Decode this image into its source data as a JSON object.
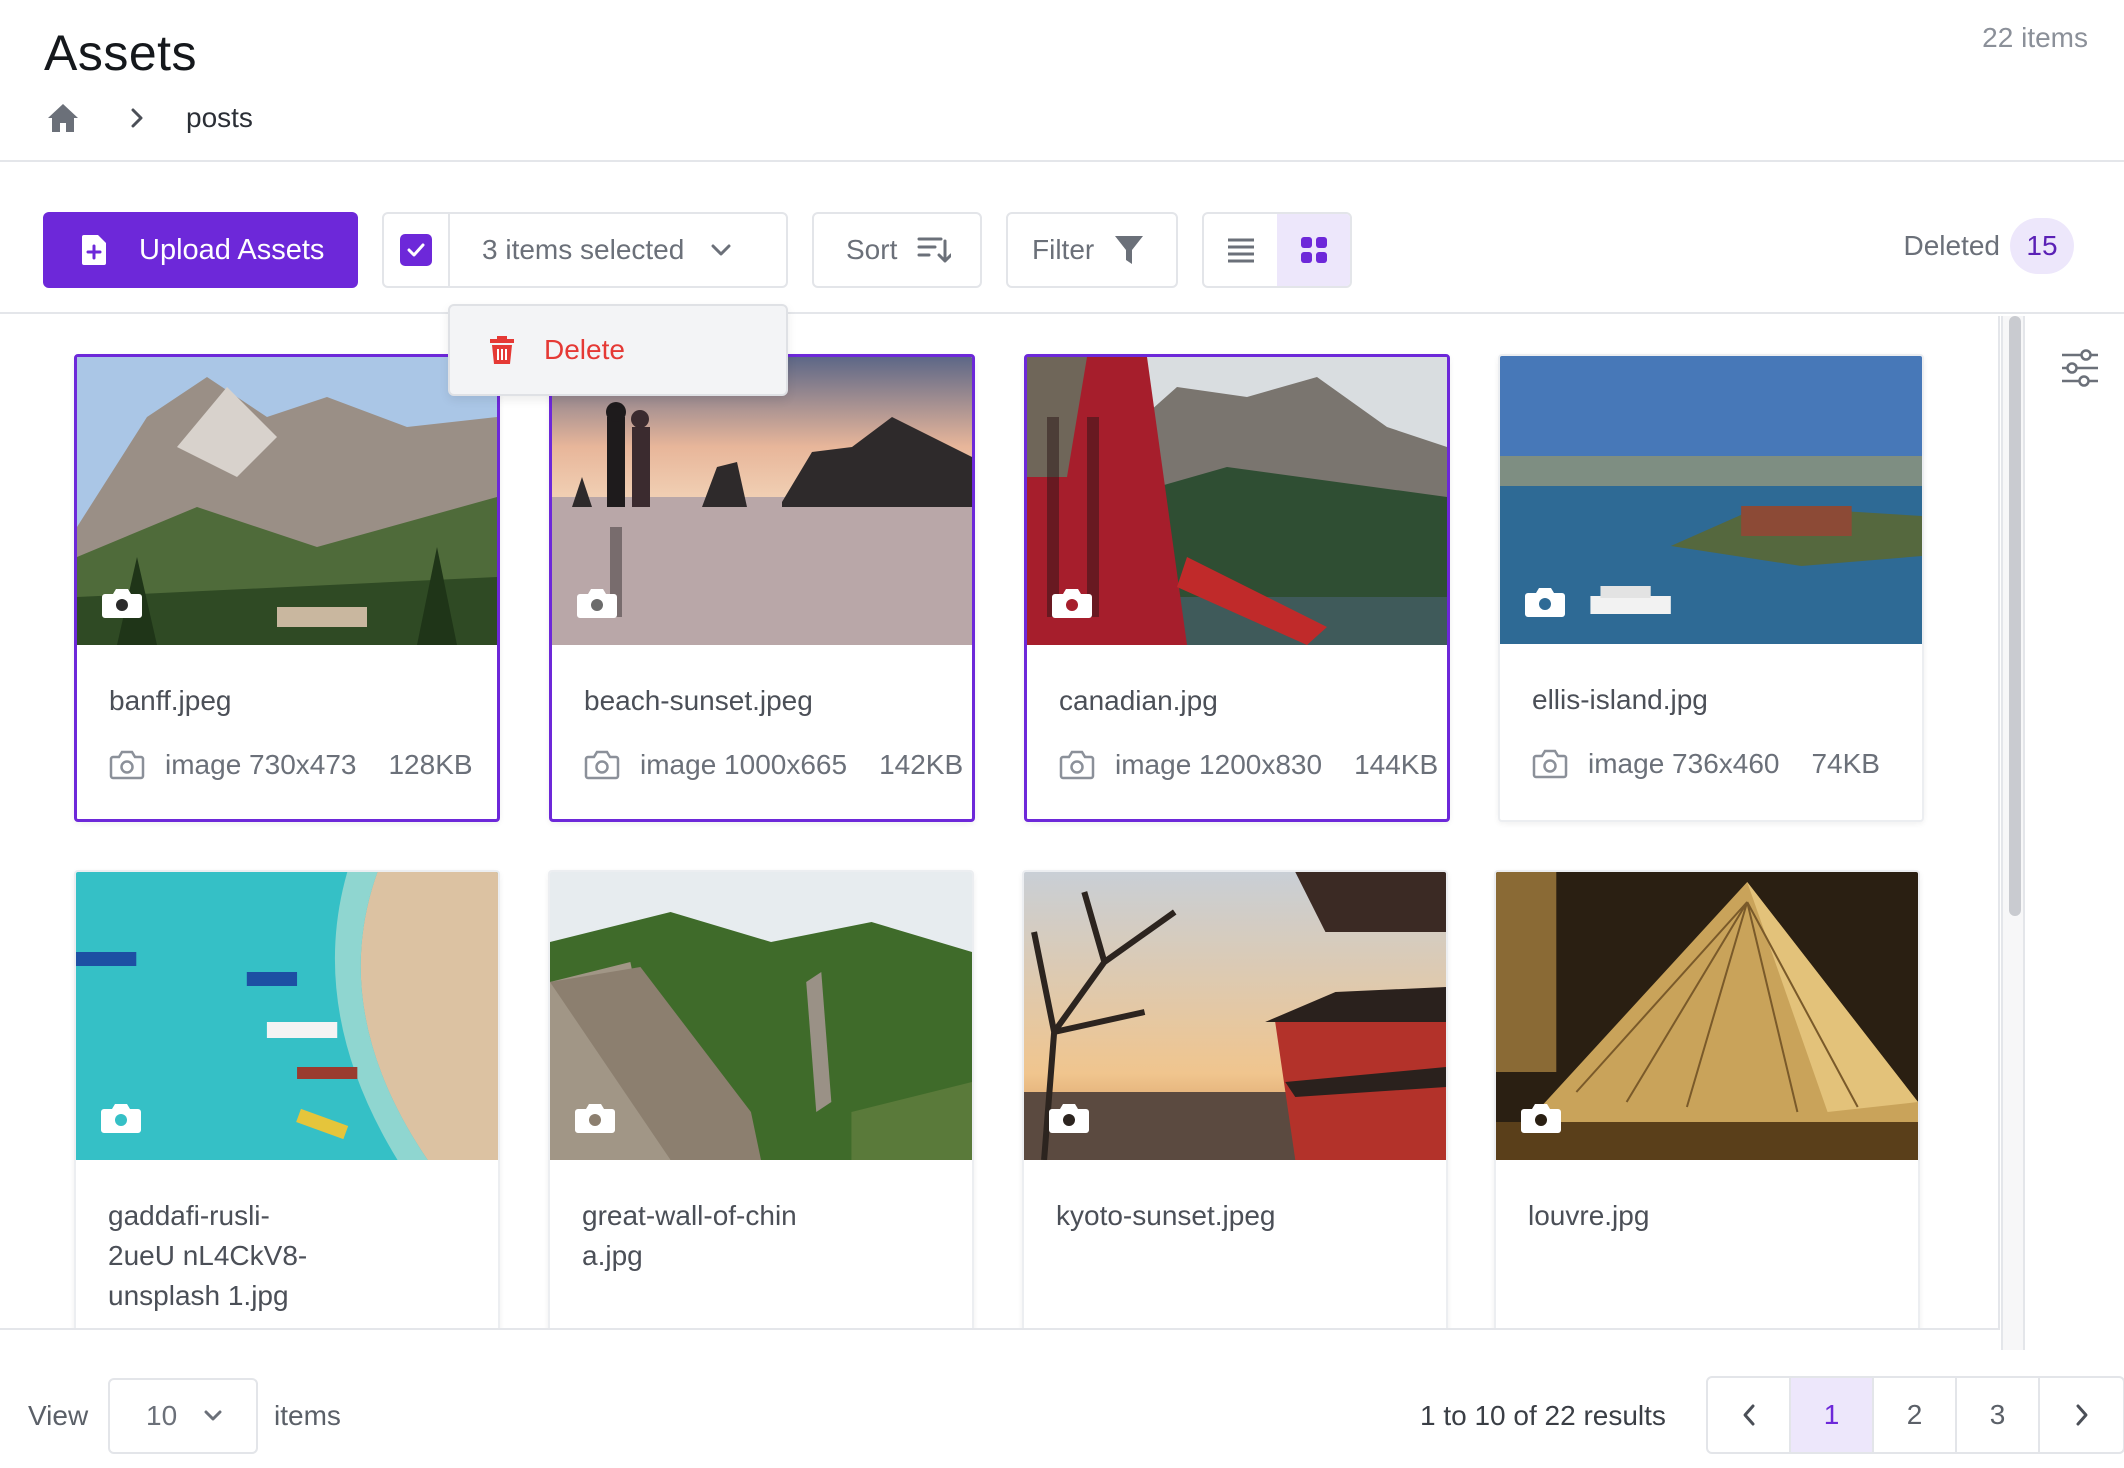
{
  "header": {
    "title": "Assets",
    "item_count": "22 items",
    "breadcrumb": [
      "posts"
    ]
  },
  "toolbar": {
    "upload_label": "Upload Assets",
    "selection_label": "3 items selected",
    "sort_label": "Sort",
    "filter_label": "Filter",
    "deleted_label": "Deleted",
    "deleted_count": "15",
    "active_view": "grid"
  },
  "dropdown": {
    "delete_label": "Delete"
  },
  "assets": [
    {
      "name": "banff.jpeg",
      "type": "image",
      "dims": "730x473",
      "size": "128KB",
      "selected": true
    },
    {
      "name": "beach-sunset.jpeg",
      "type": "image",
      "dims": "1000x665",
      "size": "142KB",
      "selected": true
    },
    {
      "name": "canadian.jpg",
      "type": "image",
      "dims": "1200x830",
      "size": "144KB",
      "selected": true
    },
    {
      "name": "ellis-island.jpg",
      "type": "image",
      "dims": "736x460",
      "size": "74KB",
      "selected": false
    },
    {
      "name": "gaddafi-rusli-2ueU nL4CkV8-unsplash 1.jpg",
      "selected": false
    },
    {
      "name": "great-wall-of-chin a.jpg",
      "selected": false
    },
    {
      "name": "kyoto-sunset.jpeg",
      "selected": false
    },
    {
      "name": "louvre.jpg",
      "selected": false
    }
  ],
  "footer": {
    "view_label": "View",
    "per_page": "10",
    "items_label": "items",
    "results": "1 to 10 of 22 results",
    "pages": [
      "1",
      "2",
      "3"
    ],
    "current_page": "1"
  },
  "colors": {
    "accent": "#6d28d9",
    "accent_light": "#ede7fb",
    "danger": "#e53935"
  }
}
